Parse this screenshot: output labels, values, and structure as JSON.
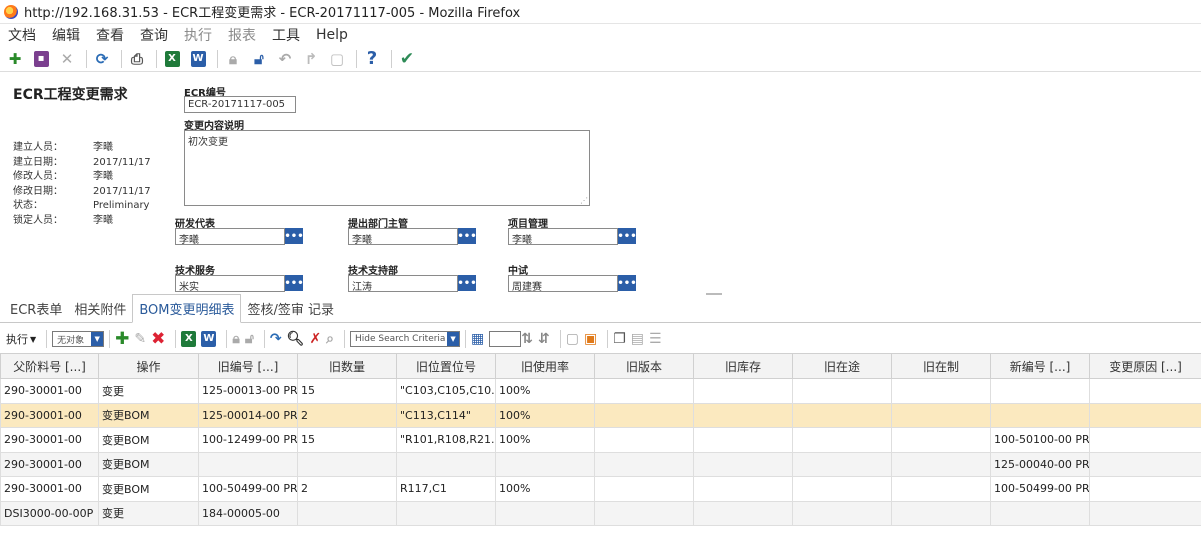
{
  "window": {
    "title": "http://192.168.31.53 - ECR工程变更需求 - ECR-20171117-005 - Mozilla Firefox"
  },
  "menu": [
    "文档",
    "编辑",
    "查看",
    "查询",
    "执行",
    "报表",
    "工具",
    "Help"
  ],
  "form": {
    "title": "ECR工程变更需求",
    "meta": [
      {
        "label": "建立人员：",
        "value": "李曦"
      },
      {
        "label": "建立日期：",
        "value": "2017/11/17"
      },
      {
        "label": "修改人员：",
        "value": "李曦"
      },
      {
        "label": "修改日期：",
        "value": "2017/11/17"
      },
      {
        "label": "状态：",
        "value": "Preliminary"
      },
      {
        "label": "锁定人员：",
        "value": "李曦"
      }
    ],
    "ecr_number_label": "ECR编号",
    "ecr_number": "ECR-20171117-005",
    "description_label": "变更内容说明",
    "description": "初次变更",
    "fields": [
      {
        "label": "研发代表",
        "value": "李曦"
      },
      {
        "label": "提出部门主管",
        "value": "李曦"
      },
      {
        "label": "项目管理",
        "value": "李曦"
      },
      {
        "label": "技术服务",
        "value": "米实"
      },
      {
        "label": "技术支持部",
        "value": "江涛"
      },
      {
        "label": "中试",
        "value": "周建赛"
      }
    ]
  },
  "tabs": [
    "ECR表单",
    "相关附件",
    "BOM变更明细表",
    "签核/签审 记录"
  ],
  "grid_toolbar": {
    "execute_label": "执行",
    "object_select": "无对象",
    "search_criteria": "Hide Search Criteria"
  },
  "table": {
    "headers": [
      "父阶料号 [...]",
      "操作",
      "旧编号 [...]",
      "旧数量",
      "旧位置位号",
      "旧使用率",
      "旧版本",
      "旧库存",
      "旧在途",
      "旧在制",
      "新编号 [...]",
      "变更原因 [...]"
    ],
    "rows": [
      [
        "290-30001-00",
        "变更",
        "125-00013-00 PR...",
        "15",
        "\"C103,C105,C10...",
        "100%",
        "",
        "",
        "",
        "",
        "",
        ""
      ],
      [
        "290-30001-00",
        "变更BOM",
        "125-00014-00 PR...",
        "2",
        "\"C113,C114\"",
        "100%",
        "",
        "",
        "",
        "",
        "",
        ""
      ],
      [
        "290-30001-00",
        "变更BOM",
        "100-12499-00 PR...",
        "15",
        "\"R101,R108,R21...",
        "100%",
        "",
        "",
        "",
        "",
        "100-50100-00 PR...",
        ""
      ],
      [
        "290-30001-00",
        "变更BOM",
        "",
        "",
        "",
        "",
        "",
        "",
        "",
        "",
        "125-00040-00 PR...",
        ""
      ],
      [
        "290-30001-00",
        "变更BOM",
        "100-50499-00 PR...",
        "2",
        "R117,C1",
        "100%",
        "",
        "",
        "",
        "",
        "100-50499-00 PR...",
        ""
      ],
      [
        "DSI3000-00-00P",
        "变更",
        "184-00005-00",
        "",
        "",
        "",
        "",
        "",
        "",
        "",
        "",
        ""
      ]
    ]
  }
}
